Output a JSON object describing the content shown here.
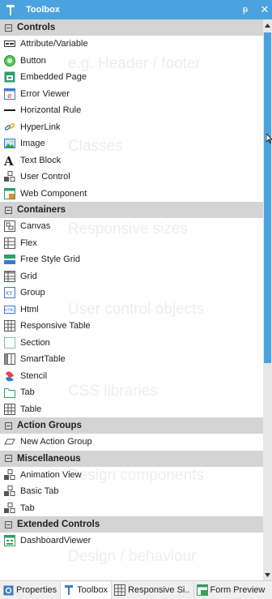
{
  "panel": {
    "title": "Toolbox",
    "pin_glyph": "ᵽ",
    "close_glyph": "✕"
  },
  "watermarks": [
    "e.g. Header / footer",
    "Classes",
    "Responsive sizes",
    "User control objects",
    "CSS libraries",
    "Design components",
    "Design / behaviour"
  ],
  "categories": [
    {
      "label": "Controls",
      "items": [
        {
          "label": "Attribute/Variable",
          "icon": "attribute-variable-icon"
        },
        {
          "label": "Button",
          "icon": "button-icon"
        },
        {
          "label": "Embedded Page",
          "icon": "embedded-page-icon"
        },
        {
          "label": "Error Viewer",
          "icon": "error-viewer-icon"
        },
        {
          "label": "Horizontal Rule",
          "icon": "horizontal-rule-icon"
        },
        {
          "label": "HyperLink",
          "icon": "hyperlink-icon"
        },
        {
          "label": "Image",
          "icon": "image-icon"
        },
        {
          "label": "Text Block",
          "icon": "text-block-icon"
        },
        {
          "label": "User Control",
          "icon": "user-control-icon"
        },
        {
          "label": "Web Component",
          "icon": "web-component-icon"
        }
      ]
    },
    {
      "label": "Containers",
      "items": [
        {
          "label": "Canvas",
          "icon": "canvas-icon"
        },
        {
          "label": "Flex",
          "icon": "flex-icon"
        },
        {
          "label": "Free Style Grid",
          "icon": "free-style-grid-icon"
        },
        {
          "label": "Grid",
          "icon": "grid-icon"
        },
        {
          "label": "Group",
          "icon": "group-icon"
        },
        {
          "label": "Html",
          "icon": "html-icon"
        },
        {
          "label": "Responsive Table",
          "icon": "responsive-table-icon"
        },
        {
          "label": "Section",
          "icon": "section-icon"
        },
        {
          "label": "SmartTable",
          "icon": "smarttable-icon"
        },
        {
          "label": "Stencil",
          "icon": "stencil-icon"
        },
        {
          "label": "Tab",
          "icon": "tab-icon"
        },
        {
          "label": "Table",
          "icon": "table-icon"
        }
      ]
    },
    {
      "label": "Action Groups",
      "items": [
        {
          "label": "New Action Group",
          "icon": "action-group-icon"
        }
      ]
    },
    {
      "label": "Miscellaneous",
      "items": [
        {
          "label": "Animation View",
          "icon": "animation-view-icon"
        },
        {
          "label": "Basic Tab",
          "icon": "basic-tab-icon"
        },
        {
          "label": "Tab",
          "icon": "tab-component-icon"
        }
      ]
    },
    {
      "label": "Extended Controls",
      "items": [
        {
          "label": "DashboardViewer",
          "icon": "dashboard-viewer-icon"
        }
      ]
    }
  ],
  "bottom_tabs": [
    {
      "label": "Properties",
      "icon": "properties-gear-icon",
      "active": false
    },
    {
      "label": "Toolbox",
      "icon": "toolbox-icon",
      "active": true
    },
    {
      "label": "Responsive Si..",
      "icon": "responsive-sizes-icon",
      "active": false
    },
    {
      "label": "Form Preview",
      "icon": "form-preview-icon",
      "active": false
    }
  ],
  "colors": {
    "title_bar": "#4aa3df",
    "category_header": "#d4d4d4",
    "scroll_thumb": "#4aa3df",
    "watermark": "#ededed"
  }
}
